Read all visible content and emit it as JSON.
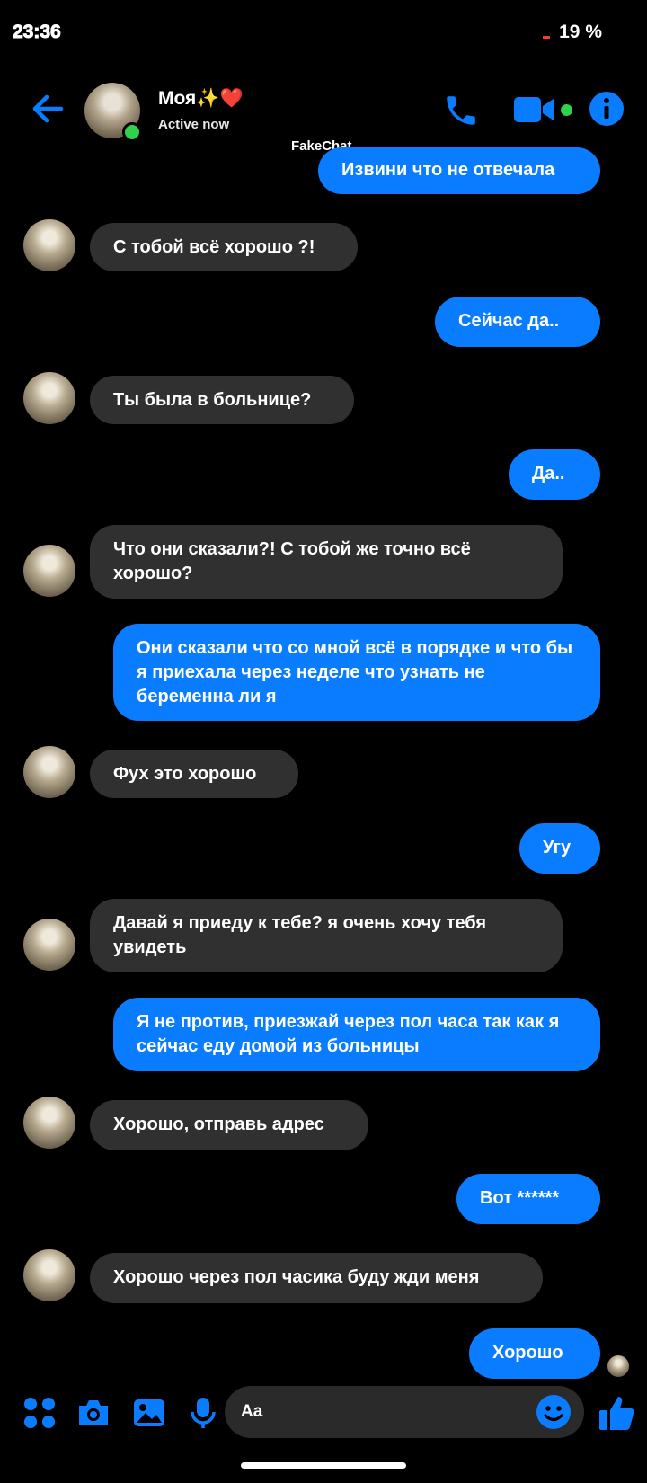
{
  "status_bar": {
    "time": "23:36",
    "battery": "19 %"
  },
  "header": {
    "contact_name": "Моя✨❤️",
    "contact_status": "Active now",
    "watermark": "FakeChat"
  },
  "messages": [
    {
      "side": "me",
      "text": "Извини что не отвечала"
    },
    {
      "side": "them",
      "text": "С тобой всё хорошо ?!"
    },
    {
      "side": "me",
      "text": "Сейчас да.."
    },
    {
      "side": "them",
      "text": "Ты была в больнице?"
    },
    {
      "side": "me",
      "text": "Да.."
    },
    {
      "side": "them",
      "text": "Что они сказали?! С тобой же точно всё хорошо?"
    },
    {
      "side": "me",
      "text": "Они сказали что со мной всё в порядке и что бы я приехала через неделе что узнать не беременна ли я"
    },
    {
      "side": "them",
      "text": "Фух это хорошо"
    },
    {
      "side": "me",
      "text": "Угу"
    },
    {
      "side": "them",
      "text": "Давай я приеду к тебе? я очень хочу тебя увидеть"
    },
    {
      "side": "me",
      "text": "Я не против, приезжай через пол часа так как я сейчас еду домой из больницы"
    },
    {
      "side": "them",
      "text": "Хорошо, отправь адрес"
    },
    {
      "side": "me",
      "text": "Вот ******"
    },
    {
      "side": "them",
      "text": "Хорошо через пол часика буду жди меня"
    },
    {
      "side": "me",
      "text": "Хорошо"
    }
  ],
  "composer": {
    "placeholder": "Aa"
  },
  "colors": {
    "accent": "#0a7cff",
    "incoming_bubble": "#303030",
    "online": "#2fd24a"
  },
  "icons": [
    "back-arrow-icon",
    "phone-icon",
    "video-camera-icon",
    "info-icon",
    "apps-icon",
    "camera-icon",
    "gallery-icon",
    "microphone-icon",
    "emoji-icon",
    "thumbs-up-icon"
  ]
}
